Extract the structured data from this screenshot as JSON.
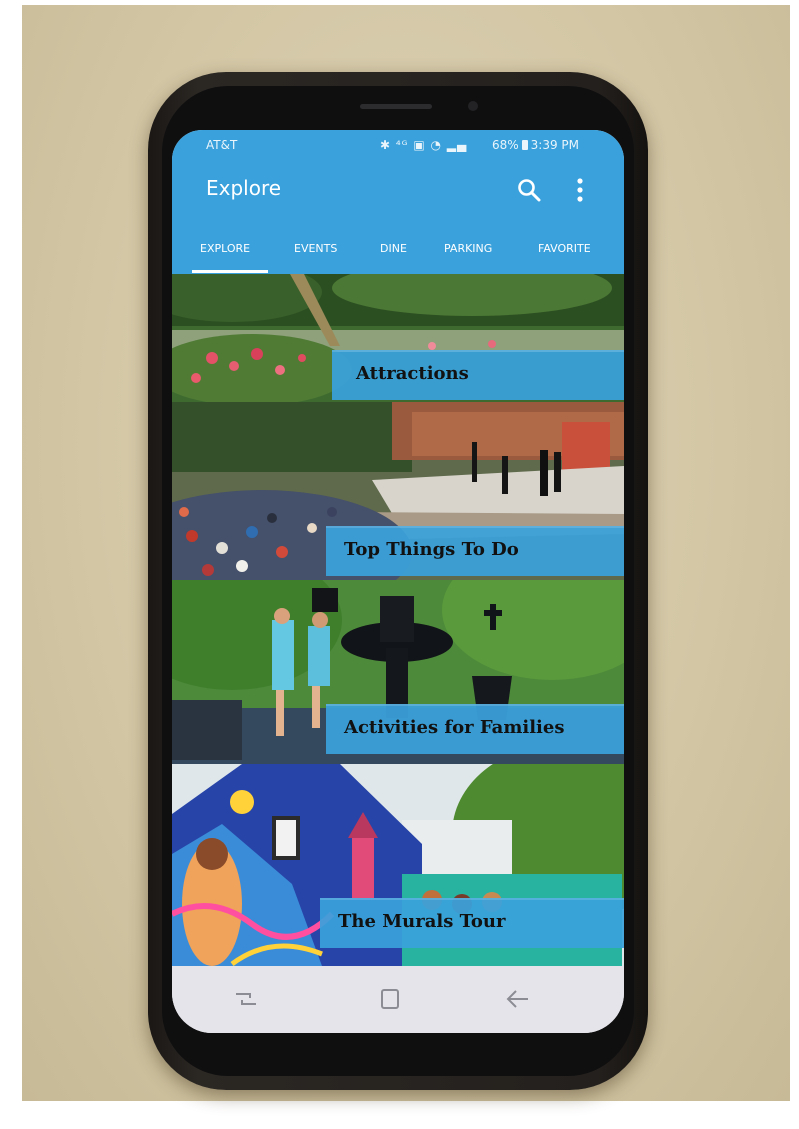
{
  "status_bar": {
    "carrier": "AT&T",
    "icons": "✱ ⁴ᴳ ▣ ◔ ▂▄",
    "battery": "68%",
    "time": "3:39 PM"
  },
  "app_bar": {
    "title": "Explore",
    "search_icon": "search-icon",
    "more_icon": "more-vertical-icon"
  },
  "tabs": [
    {
      "label": "EXPLORE",
      "selected": true
    },
    {
      "label": "EVENTS",
      "selected": false
    },
    {
      "label": "DINE",
      "selected": false
    },
    {
      "label": "PARKING",
      "selected": false
    },
    {
      "label": "FAVORITE",
      "selected": false
    }
  ],
  "tiles": [
    {
      "label": "Attractions"
    },
    {
      "label": "Top Things To Do"
    },
    {
      "label": "Activities for Families"
    },
    {
      "label": "The Murals Tour"
    }
  ],
  "nav_bar": {
    "recents_icon": "recent-apps-icon",
    "home_icon": "home-square-icon",
    "back_icon": "back-arrow-icon"
  },
  "colors": {
    "accent": "#3aa1dc",
    "tile_label": "#111111",
    "nav_bar": "#e5e4ea"
  }
}
